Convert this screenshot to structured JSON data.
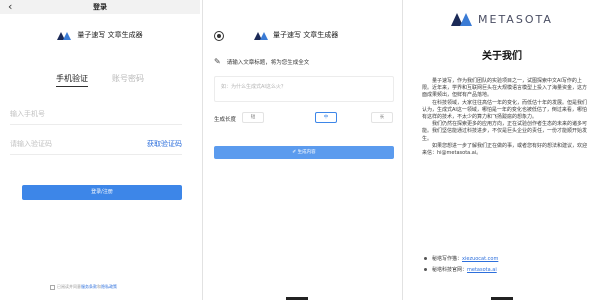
{
  "login": {
    "title": "登录",
    "back_icon": "chevron-left-icon",
    "brand": "量子速写 文章生成器",
    "tabs": [
      "手机验证",
      "账号密码"
    ],
    "phone_placeholder": "输入手机号",
    "code_placeholder": "请输入验证码",
    "get_code": "获取验证码",
    "submit": "登录/注册",
    "agree_prefix": "已阅读并同意",
    "agree_terms": "服务条款",
    "agree_and": "和",
    "agree_privacy": "隐私政策"
  },
  "generator": {
    "brand": "量子速写 文章生成器",
    "prompt_hint": "请输入文章标题，将为您生成全文",
    "placeholder": "如：为什么生成式AI这么火？",
    "length_label": "生成长度",
    "length_options": [
      "短",
      "中",
      "长"
    ],
    "selected_length": "中",
    "generate": "生成内容"
  },
  "about": {
    "logo_text": "METASOTA",
    "title": "关于我们",
    "paragraphs": [
      "量子速写，作为我们团队的实验项目之一，试图探索中文AI写作的上限。近年来，学界和互联网巨头在大规模语言模型上投入了海量资金，这方面成果频出，但鲜有产品落地。",
      "在科技领域，大家往往高估一年的变化，而低估十年的发展。但是我们认为，生成式AI这一领域，哪怕是一年的变化也被低估了，倒过来看，哪怕有这样的技术，不太少的算力和飞扬跋扈的想象力。",
      "我们仍然在探索更多的应用方向，正在试验创作者生态的未来的诸多可能。我们坚信能通过科技进步，不仅是巨头企业的责任，一份才能顺开始发生。",
      "如果您想进一步了解我们正在做的事，或者您有好的想法和建议，欢迎来信：hi@metasota.ai。"
    ],
    "links": [
      {
        "label": "秘塔写作猫：",
        "url": "xiezuocat.com"
      },
      {
        "label": "秘塔科技官网：",
        "url": "metasota.ai"
      }
    ]
  }
}
